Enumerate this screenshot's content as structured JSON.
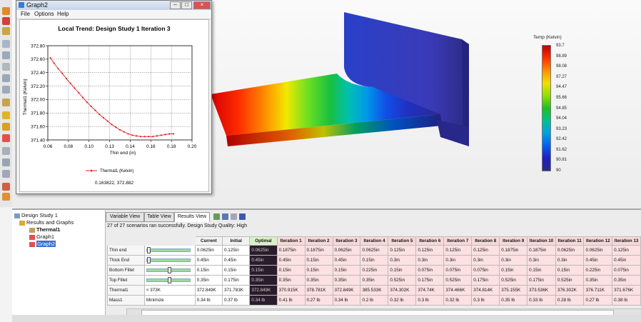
{
  "graph_window": {
    "title": "Graph2",
    "menu": [
      "File",
      "Options",
      "Help"
    ],
    "chart_title": "Local Trend: Design Study 1 Iteration 3",
    "xlabel": "Thin end (in)",
    "ylabel": "Thermal1 (Kelvin)",
    "legend": "Thermal1 (Kelvin)",
    "readout": "0.163822, 372.882"
  },
  "chart_data": {
    "type": "line",
    "title": "Local Trend: Design Study 1 Iteration 3",
    "xlabel": "Thin end (in)",
    "ylabel": "Thermal1 (Kelvin)",
    "xlim": [
      0.06,
      0.2
    ],
    "ylim": [
      371.4,
      372.8
    ],
    "x_ticks": [
      "0.06",
      "0.08",
      "0.10",
      "0.13",
      "0.14",
      "0.16",
      "0.18",
      "0.20"
    ],
    "y_ticks": [
      "372.80",
      "372.60",
      "372.40",
      "372.20",
      "372.00",
      "371.80",
      "371.60",
      "371.40"
    ],
    "grid": true,
    "legend_position": "bottom",
    "series": [
      {
        "name": "Thermal1 (Kelvin)",
        "color": "#e02020",
        "x": [
          0.0625,
          0.066,
          0.07,
          0.074,
          0.078,
          0.082,
          0.086,
          0.09,
          0.094,
          0.098,
          0.102,
          0.106,
          0.11,
          0.114,
          0.118,
          0.122,
          0.126,
          0.13,
          0.134,
          0.138,
          0.142,
          0.146,
          0.15,
          0.154,
          0.158,
          0.162,
          0.166,
          0.17,
          0.174,
          0.178,
          0.182
        ],
        "y": [
          372.62,
          372.54,
          372.46,
          372.39,
          372.31,
          372.24,
          372.17,
          372.1,
          372.03,
          371.96,
          371.9,
          371.84,
          371.78,
          371.73,
          371.68,
          371.63,
          371.59,
          371.55,
          371.52,
          371.49,
          371.47,
          371.46,
          371.45,
          371.45,
          371.45,
          371.45,
          371.46,
          371.47,
          371.48,
          371.49,
          371.49
        ]
      }
    ]
  },
  "legend_panel": {
    "title": "Temp (Kelvin)",
    "ticks": [
      "93.7",
      "98.89",
      "98.08",
      "97.27",
      "94.47",
      "95.66",
      "94.85",
      "94.04",
      "93.23",
      "92.42",
      "91.62",
      "90.81",
      "90"
    ]
  },
  "tree": {
    "root": "Design Study 1",
    "group": "Results and Graphs",
    "items": [
      "Thermal1",
      "Graph1",
      "Graph2"
    ]
  },
  "tabs": [
    "Variable View",
    "Table View",
    "Results View"
  ],
  "status": "27 of 27 scenarios ran successfully. Design Study Quality: High",
  "table": {
    "headers": [
      "Current",
      "Initial",
      "Optimal",
      "Iteration 1",
      "Iteration 2",
      "Iteration 3",
      "Iteration 4",
      "Iteration 5",
      "Iteration 6",
      "Iteration 7",
      "Iteration 8",
      "Iteration 9",
      "Iteration 10",
      "Iteration 11",
      "Iteration 12",
      "Iteration 13"
    ],
    "rows": [
      {
        "label": "Thin end",
        "slider": "",
        "values": [
          "0.0625in",
          "0.125in",
          "0.0625in",
          "0.1875in",
          "0.1875in",
          "0.0625in",
          "0.0625in",
          "0.125in",
          "0.125in",
          "0.125in",
          "0.125in",
          "0.1875in",
          "0.1875in",
          "0.0625in",
          "0.0625in",
          "0.125in"
        ]
      },
      {
        "label": "Thick End",
        "slider": "",
        "values": [
          "0.45in",
          "0.45in",
          "0.45in",
          "0.45in",
          "0.15in",
          "0.45in",
          "0.15in",
          "0.3in",
          "0.3in",
          "0.3in",
          "0.3in",
          "0.3in",
          "0.3in",
          "0.3in",
          "0.45in",
          "0.45in"
        ]
      },
      {
        "label": "Bottom Fillet",
        "slider": "",
        "values": [
          "0.15in",
          "0.15in",
          "0.15in",
          "0.15in",
          "0.15in",
          "0.15in",
          "0.225in",
          "0.15in",
          "0.075in",
          "0.075in",
          "0.075in",
          "0.15in",
          "0.15in",
          "0.15in",
          "0.225in",
          "0.075in"
        ]
      },
      {
        "label": "Top Fillet",
        "slider": "",
        "values": [
          "0.35in",
          "0.175in",
          "0.35in",
          "0.35in",
          "0.35in",
          "0.35in",
          "0.35in",
          "0.525in",
          "0.175in",
          "0.525in",
          "0.175in",
          "0.525in",
          "0.175in",
          "0.525in",
          "0.35in",
          "0.35in"
        ]
      },
      {
        "label": "Thermal1",
        "slider": "< 373K",
        "values": [
          "372.849K",
          "371.783K",
          "372.849K",
          "370.915K",
          "378.781K",
          "372.849K",
          "385.533K",
          "374.302K",
          "374.74K",
          "374.466K",
          "374.814K",
          "375.155K",
          "373.536K",
          "376.302K",
          "376.711K",
          "371.676K"
        ]
      },
      {
        "label": "Mass1",
        "slider": "Minimize",
        "values": [
          "0.34 lb",
          "0.37 lb",
          "0.34 lb",
          "0.41 lb",
          "0.27 lb",
          "0.34 lb",
          "0.2 lb",
          "0.32 lb",
          "0.3 lb",
          "0.32 lb",
          "0.3 lb",
          "0.35 lb",
          "0.33 lb",
          "0.28 lb",
          "0.27 lb",
          "0.38 lb"
        ]
      }
    ]
  }
}
